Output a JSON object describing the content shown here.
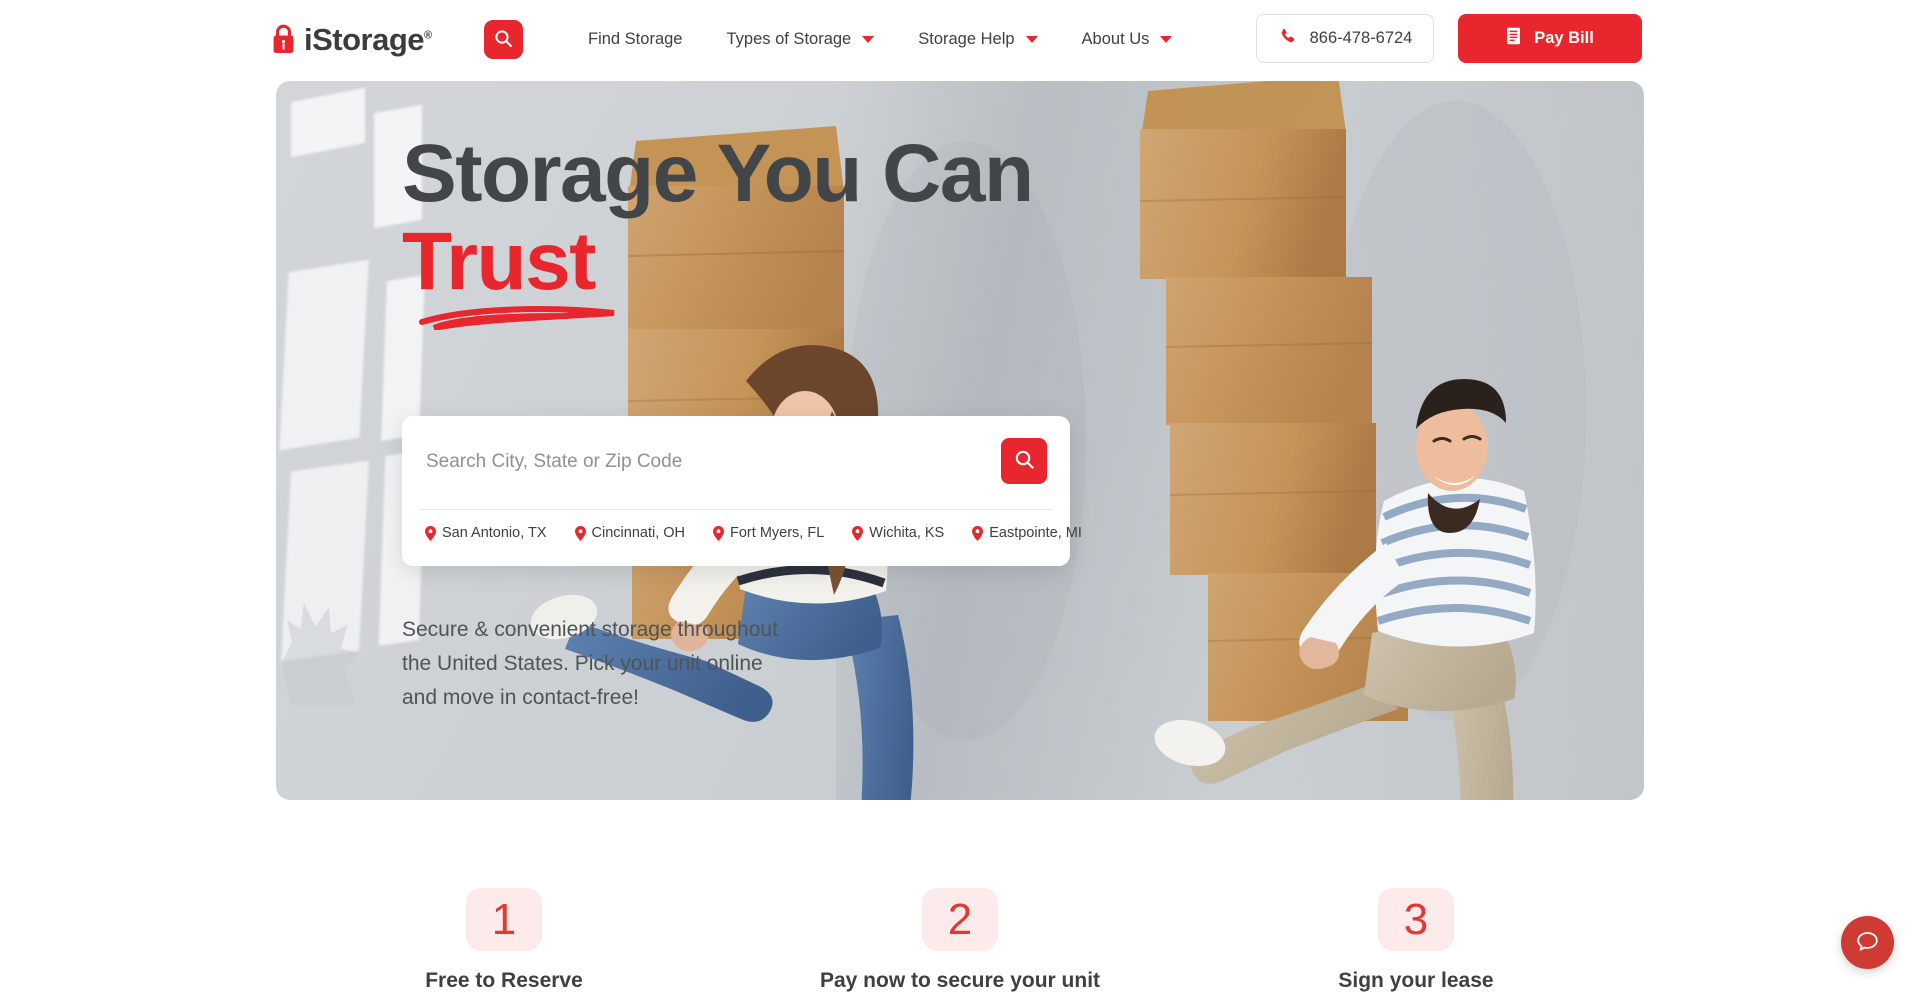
{
  "header": {
    "logo": {
      "name": "iStorage",
      "registered_mark": "®",
      "icon": "padlock-icon"
    },
    "search_toggle_icon": "search-icon",
    "nav": [
      {
        "label": "Find Storage",
        "has_dropdown": false
      },
      {
        "label": "Types of Storage",
        "has_dropdown": true
      },
      {
        "label": "Storage Help",
        "has_dropdown": true
      },
      {
        "label": "About Us",
        "has_dropdown": true
      }
    ],
    "phone": {
      "label": "866-478-6724",
      "icon": "phone-icon"
    },
    "pay_bill": {
      "label": "Pay Bill",
      "icon": "receipt-icon"
    }
  },
  "hero": {
    "heading_line1": "Storage You Can",
    "heading_line2": "Trust",
    "subtext": "Secure & convenient storage throughout the United States. Pick your unit online and move in contact-free!",
    "search": {
      "placeholder": "Search City, State or Zip Code",
      "value": "",
      "button_icon": "search-icon",
      "cities": [
        "San Antonio, TX",
        "Cincinnati, OH",
        "Fort Myers, FL",
        "Wichita, KS",
        "Eastpointe, MI"
      ]
    }
  },
  "steps": [
    {
      "number": "1",
      "label": "Free to Reserve"
    },
    {
      "number": "2",
      "label": "Pay now to secure your unit"
    },
    {
      "number": "3",
      "label": "Sign your lease"
    }
  ],
  "chat": {
    "icon": "chat-bubble-icon"
  },
  "colors": {
    "brand_red": "#e8262d",
    "text_dark": "#3d4144",
    "heading_gray": "#434648",
    "badge_bg": "#fdeaea",
    "chat_red": "#cf3a32"
  }
}
